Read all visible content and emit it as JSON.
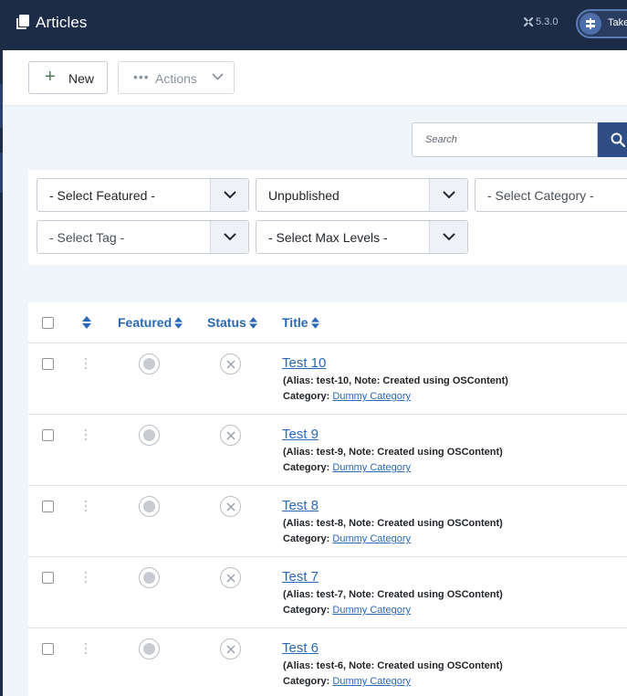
{
  "header": {
    "title": "Articles",
    "version": "5.3.0",
    "tour_label": "Take"
  },
  "toolbar": {
    "new_label": "New",
    "actions_label": "Actions"
  },
  "search": {
    "placeholder": "Search"
  },
  "filters": {
    "featured": "- Select Featured -",
    "status": "Unpublished",
    "category": "- Select Category -",
    "tag": "- Select Tag -",
    "max_levels": "- Select Max Levels -"
  },
  "table": {
    "columns": {
      "featured": "Featured",
      "status": "Status",
      "title": "Title"
    },
    "category_prefix": "Category:",
    "rows": [
      {
        "title": "Test 10",
        "alias": "(Alias: test-10, Note: Created using OSContent)",
        "category": "Dummy Category"
      },
      {
        "title": "Test 9",
        "alias": "(Alias: test-9, Note: Created using OSContent)",
        "category": "Dummy Category"
      },
      {
        "title": "Test 8",
        "alias": "(Alias: test-8, Note: Created using OSContent)",
        "category": "Dummy Category"
      },
      {
        "title": "Test 7",
        "alias": "(Alias: test-7, Note: Created using OSContent)",
        "category": "Dummy Category"
      },
      {
        "title": "Test 6",
        "alias": "(Alias: test-6, Note: Created using OSContent)",
        "category": "Dummy Category"
      }
    ]
  }
}
